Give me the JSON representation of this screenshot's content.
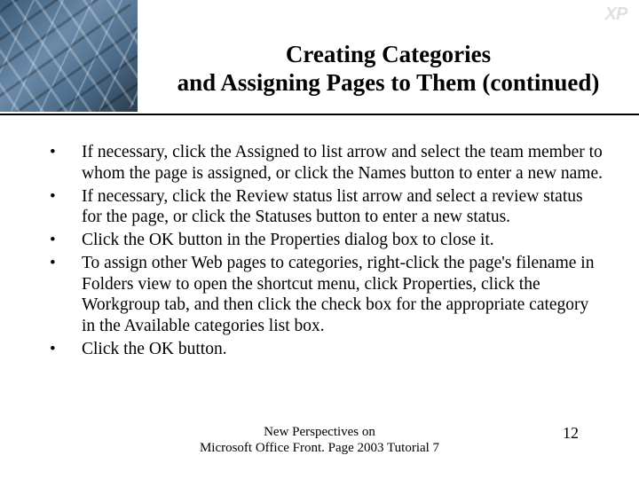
{
  "header": {
    "title_line1": "Creating Categories",
    "title_line2": "and Assigning Pages to Them (continued)",
    "badge": "XP",
    "image_alt": "spherical-lattice-photo"
  },
  "bullets": [
    "If necessary, click the Assigned to list arrow and select the team member to whom the page is assigned, or click the Names button to enter a new name.",
    "If necessary, click the Review status list arrow and select a review status for the page, or click the Statuses button to enter a new status.",
    "Click the OK button in the Properties dialog box to close it.",
    "To assign other Web pages to categories, right-click the page's filename in Folders view to open the shortcut menu, click Properties, click the Workgroup tab, and then click the check box for the appropriate category in the Available categories list box.",
    "Click the OK button."
  ],
  "footer": {
    "line1": "New Perspectives on",
    "line2": "Microsoft Office Front. Page 2003 Tutorial 7",
    "page_number": "12"
  }
}
